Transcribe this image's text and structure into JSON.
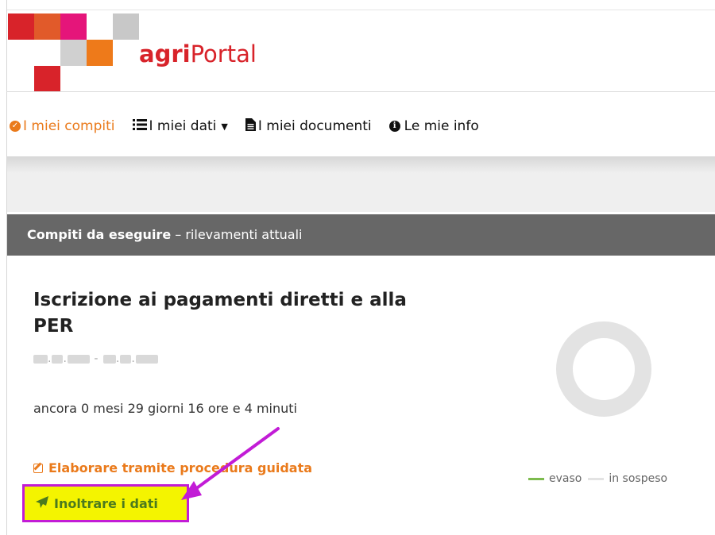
{
  "header": {
    "brand_prefix": "agri",
    "brand_suffix": "Portal"
  },
  "nav": {
    "items": [
      {
        "label": "I miei compiti",
        "icon": "check-circle-icon",
        "active": true
      },
      {
        "label": "I miei dati",
        "icon": "list-icon",
        "dropdown": true
      },
      {
        "label": "I miei documenti",
        "icon": "document-icon"
      },
      {
        "label": "Le mie info",
        "icon": "info-circle-icon"
      }
    ]
  },
  "section": {
    "title_bold": "Compiti da eseguire",
    "title_rest": " – rilevamenti attuali"
  },
  "task": {
    "title": "Iscrizione ai pagamenti diretti e alla PER",
    "remaining": "ancora 0 mesi 29 giorni 16 ore e 4 minuti",
    "actions": {
      "edit_label": "Elaborare tramite procedura guidata",
      "send_label": "Inoltrare i dati"
    }
  },
  "chart_legend": {
    "done_label": "evaso",
    "done_color": "#7dbb4e",
    "pending_label": "in sospeso",
    "pending_color": "#e3e3e3"
  },
  "colors": {
    "accent_orange": "#ea7a1b",
    "brand_red": "#d8232a",
    "highlight_yellow": "#f4f400",
    "annotation_magenta": "#c21cd6",
    "send_green": "#4c7a1e"
  }
}
